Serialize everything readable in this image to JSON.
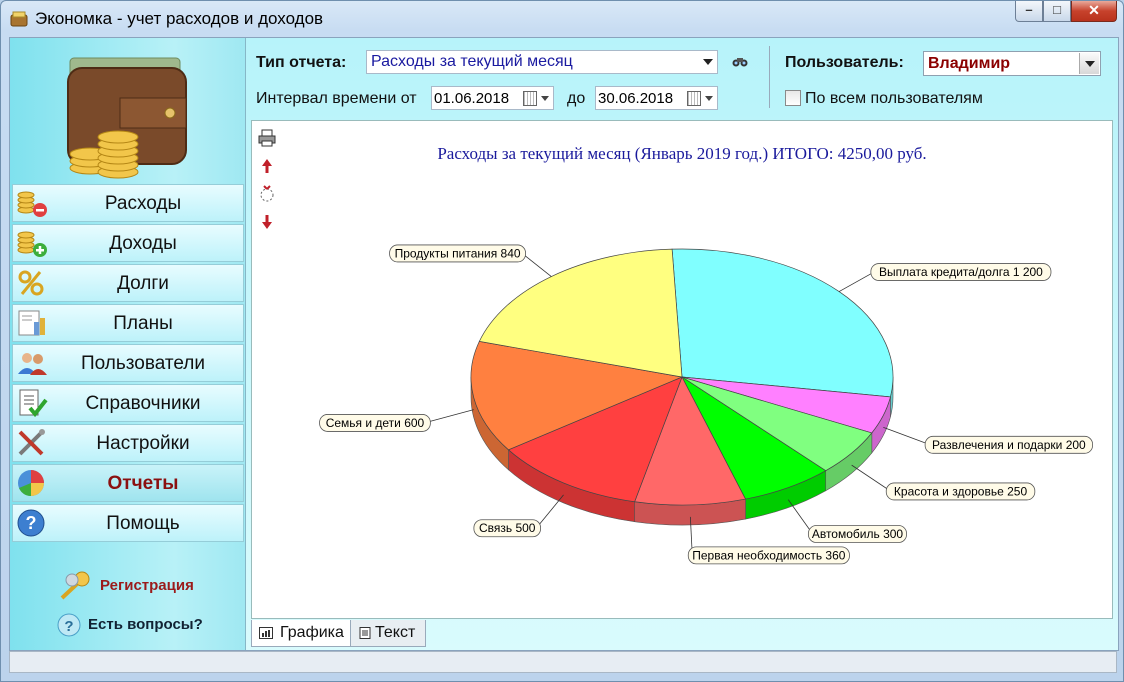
{
  "window": {
    "title": "Экономка - учет расходов и доходов",
    "minimize_symbol": "–",
    "maximize_symbol": "□",
    "close_symbol": "✕"
  },
  "sidebar": {
    "items": [
      {
        "label": "Расходы",
        "icon": "coins-minus-icon"
      },
      {
        "label": "Доходы",
        "icon": "coins-plus-icon"
      },
      {
        "label": "Долги",
        "icon": "percent-icon"
      },
      {
        "label": "Планы",
        "icon": "bar-chart-icon"
      },
      {
        "label": "Пользователи",
        "icon": "users-icon"
      },
      {
        "label": "Справочники",
        "icon": "checklist-icon"
      },
      {
        "label": "Настройки",
        "icon": "tools-icon"
      },
      {
        "label": "Отчеты",
        "icon": "pie-chart-icon"
      },
      {
        "label": "Помощь",
        "icon": "help-icon"
      }
    ],
    "active": "Отчеты",
    "registration_label": "Регистрация",
    "questions_label": "Есть вопросы?"
  },
  "filters": {
    "report_type_label": "Тип отчета:",
    "report_type_value": "Расходы за текущий месяц",
    "interval_label": "Интервал времени от",
    "date_from": "01.06.2018",
    "to_label": "до",
    "date_to": "30.06.2018",
    "user_label": "Пользователь:",
    "user_value": "Владимир",
    "all_users_label": "По всем пользователям",
    "all_users_checked": false
  },
  "report": {
    "title": "Расходы за текущий месяц (Январь 2019 год.) ИТОГО: 4250,00 руб."
  },
  "tabs": [
    {
      "label": "Графика",
      "active": true
    },
    {
      "label": "Текст",
      "active": false
    }
  ],
  "chart_data": {
    "type": "pie",
    "title": "Расходы за текущий месяц (Январь 2019 год.) ИТОГО: 4250,00 руб.",
    "total": 4250,
    "series": [
      {
        "label": "Выплата кредита/долга 1 200",
        "name": "Выплата кредита/долга",
        "value": 1200,
        "color": "#80ffff"
      },
      {
        "label": "Развлечения и подарки 200",
        "name": "Развлечения и подарки",
        "value": 200,
        "color": "#ff80ff"
      },
      {
        "label": "Красота и здоровье 250",
        "name": "Красота и здоровье",
        "value": 250,
        "color": "#80ff80"
      },
      {
        "label": "Автомобиль 300",
        "name": "Автомобиль",
        "value": 300,
        "color": "#00ff00"
      },
      {
        "label": "Первая необходимость 360",
        "name": "Первая необходимость",
        "value": 360,
        "color": "#ff6868"
      },
      {
        "label": "Связь 500",
        "name": "Связь",
        "value": 500,
        "color": "#ff4040"
      },
      {
        "label": "Семья и дети 600",
        "name": "Семья и дети",
        "value": 600,
        "color": "#ff8040"
      },
      {
        "label": "Продукты питания 840",
        "name": "Продукты питания",
        "value": 840,
        "color": "#ffff80"
      }
    ]
  }
}
